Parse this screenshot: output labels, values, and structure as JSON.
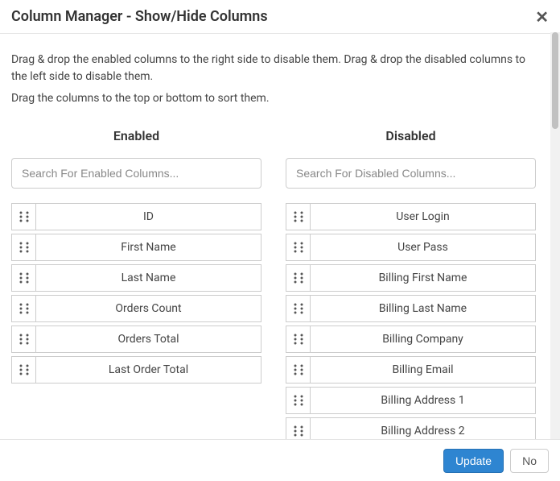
{
  "header": {
    "title": "Column Manager - Show/Hide Columns"
  },
  "instructions": {
    "line1": "Drag & drop the enabled columns to the right side to disable them. Drag & drop the disabled columns to the left side to disable them.",
    "line2": "Drag the columns to the top or bottom to sort them."
  },
  "enabled": {
    "title": "Enabled",
    "search_placeholder": "Search For Enabled Columns...",
    "items": [
      {
        "label": "ID"
      },
      {
        "label": "First Name"
      },
      {
        "label": "Last Name"
      },
      {
        "label": "Orders Count"
      },
      {
        "label": "Orders Total"
      },
      {
        "label": "Last Order Total"
      }
    ]
  },
  "disabled": {
    "title": "Disabled",
    "search_placeholder": "Search For Disabled Columns...",
    "items": [
      {
        "label": "User Login"
      },
      {
        "label": "User Pass"
      },
      {
        "label": "Billing First Name"
      },
      {
        "label": "Billing Last Name"
      },
      {
        "label": "Billing Company"
      },
      {
        "label": "Billing Email"
      },
      {
        "label": "Billing Address 1"
      },
      {
        "label": "Billing Address 2"
      }
    ]
  },
  "footer": {
    "update_label": "Update",
    "no_label": "No"
  }
}
